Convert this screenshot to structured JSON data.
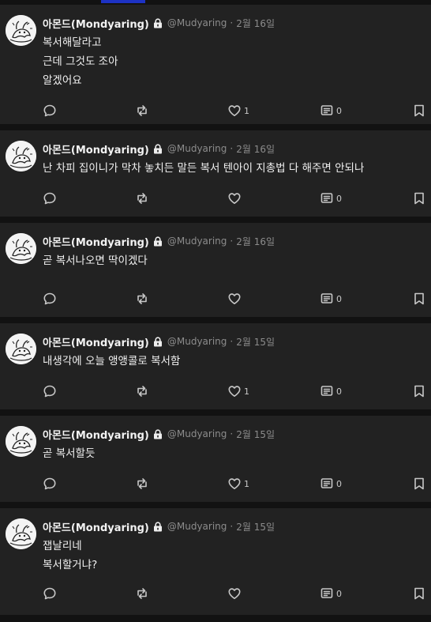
{
  "posts": [
    {
      "author": "아몬드(Mondyaring)",
      "handle": "@Mudyaring",
      "separator": "·",
      "date": "2월 16일",
      "lines": [
        "복서해달라고",
        "근데 그것도 조아",
        "알겠어요"
      ],
      "likes": "1",
      "quotes": "0"
    },
    {
      "author": "아몬드(Mondyaring)",
      "handle": "@Mudyaring",
      "separator": "·",
      "date": "2월 16일",
      "lines": [
        "난 차피 집이니가 막차 놓치든 말든 복서 텐아이 지총법 다 해주면 안되나"
      ],
      "likes": "",
      "quotes": "0"
    },
    {
      "author": "아몬드(Mondyaring)",
      "handle": "@Mudyaring",
      "separator": "·",
      "date": "2월 16일",
      "lines": [
        "곧 복서나오면 딱이겠다"
      ],
      "likes": "",
      "quotes": "0"
    },
    {
      "author": "아몬드(Mondyaring)",
      "handle": "@Mudyaring",
      "separator": "·",
      "date": "2월 15일",
      "lines": [
        "내생각에 오늘 앵앵콜로 복서함"
      ],
      "likes": "1",
      "quotes": "0"
    },
    {
      "author": "아몬드(Mondyaring)",
      "handle": "@Mudyaring",
      "separator": "·",
      "date": "2월 15일",
      "lines": [
        "곧 복서할듯"
      ],
      "likes": "1",
      "quotes": "0"
    },
    {
      "author": "아몬드(Mondyaring)",
      "handle": "@Mudyaring",
      "separator": "·",
      "date": "2월 15일",
      "lines": [
        "잽날리네",
        "복서할거냐?"
      ],
      "likes": "",
      "quotes": "0"
    }
  ]
}
